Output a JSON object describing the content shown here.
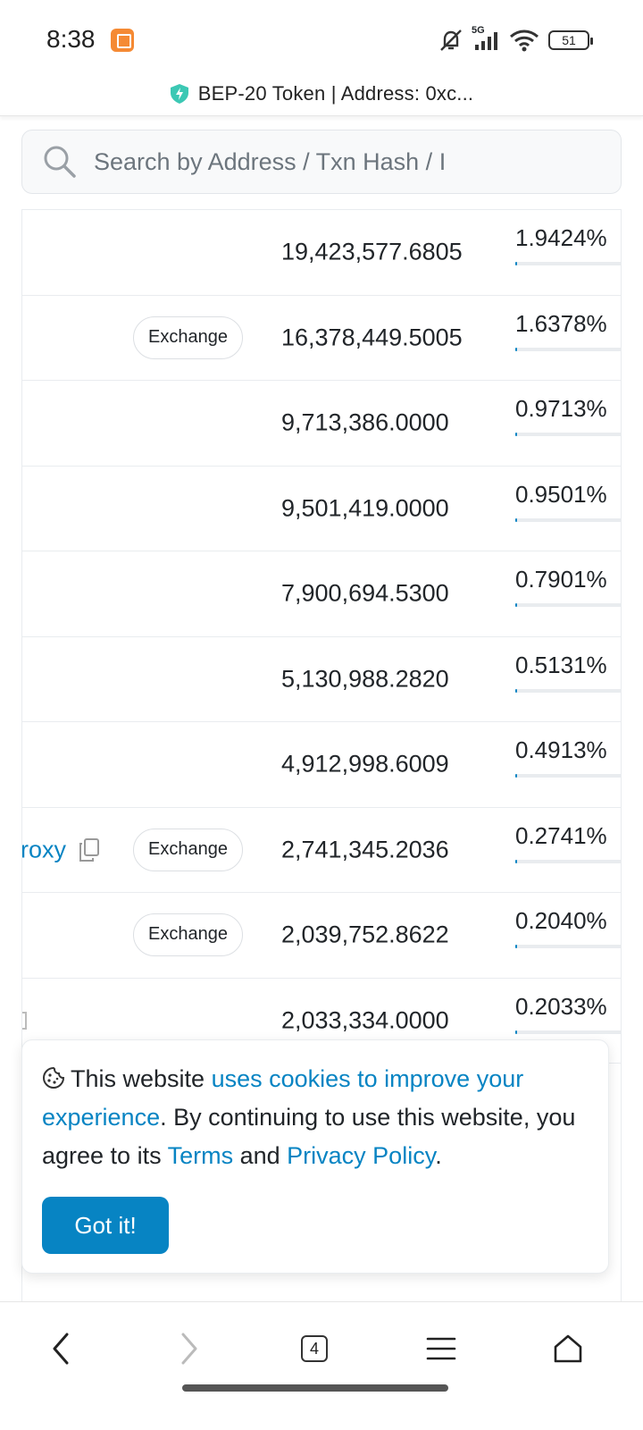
{
  "status_bar": {
    "time": "8:38",
    "network": "5G",
    "battery": "51",
    "icons": [
      "app-notification-icon",
      "mute-icon",
      "signal-icon",
      "wifi-icon",
      "battery-icon"
    ]
  },
  "browser": {
    "title": "BEP-20 Token | Address: 0xc...",
    "security_icon": "shield-icon",
    "tab_count": "4"
  },
  "search": {
    "placeholder": "Search by Address / Txn Hash / I"
  },
  "holders": {
    "tag_label": "Exchange",
    "rows": [
      {
        "quantity": "19,423,577.6805",
        "percent": "1.9424%",
        "percent_value": 1.9424,
        "tag": "",
        "address_fragment": ""
      },
      {
        "quantity": "16,378,449.5005",
        "percent": "1.6378%",
        "percent_value": 1.6378,
        "tag": "Exchange",
        "address_fragment": ""
      },
      {
        "quantity": "9,713,386.0000",
        "percent": "0.9713%",
        "percent_value": 0.9713,
        "tag": "",
        "address_fragment": ""
      },
      {
        "quantity": "9,501,419.0000",
        "percent": "0.9501%",
        "percent_value": 0.9501,
        "tag": "",
        "address_fragment": ""
      },
      {
        "quantity": "7,900,694.5300",
        "percent": "0.7901%",
        "percent_value": 0.7901,
        "tag": "",
        "address_fragment": ""
      },
      {
        "quantity": "5,130,988.2820",
        "percent": "0.5131%",
        "percent_value": 0.5131,
        "tag": "",
        "address_fragment": ""
      },
      {
        "quantity": "4,912,998.6009",
        "percent": "0.4913%",
        "percent_value": 0.4913,
        "tag": "",
        "address_fragment": ""
      },
      {
        "quantity": "2,741,345.2036",
        "percent": "0.2741%",
        "percent_value": 0.2741,
        "tag": "Exchange",
        "address_fragment": "roxy"
      },
      {
        "quantity": "2,039,752.8622",
        "percent": "0.2040%",
        "percent_value": 0.204,
        "tag": "Exchange",
        "address_fragment": ""
      },
      {
        "quantity": "2,033,334.0000",
        "percent": "0.2033%",
        "percent_value": 0.2033,
        "tag": "",
        "address_fragment": ""
      }
    ]
  },
  "cookie_banner": {
    "text_1": "This website ",
    "link_1": "uses cookies to improve your experience",
    "text_2": ". By continuing to use this website, you agree to its ",
    "link_terms": "Terms",
    "text_3": " and ",
    "link_privacy": "Privacy Policy",
    "text_4": ".",
    "button": "Got it!",
    "icon": "cookie-icon"
  },
  "bottom_nav": {
    "items": [
      "back-icon",
      "forward-icon",
      "tabs-icon",
      "menu-icon",
      "home-icon"
    ]
  },
  "colors": {
    "link": "#0784c3",
    "button": "#0784c3",
    "border": "#e9ecef"
  }
}
